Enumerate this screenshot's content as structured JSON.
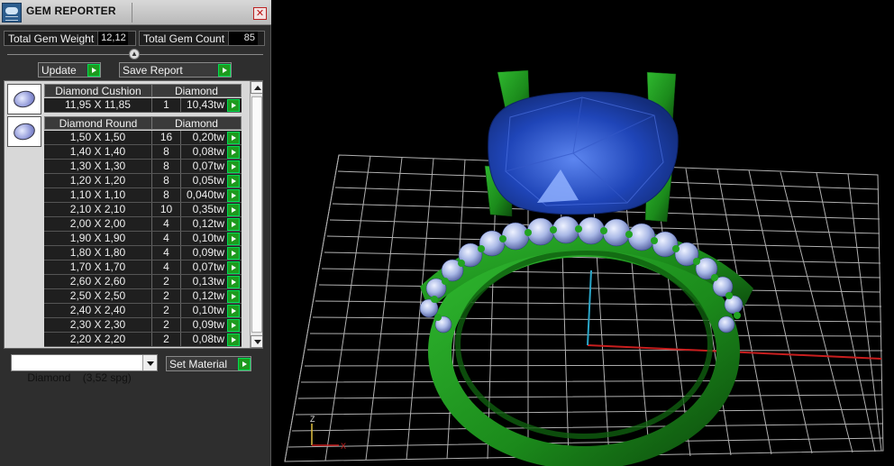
{
  "window": {
    "title": "GEM REPORTER",
    "close_symbol": "✕"
  },
  "totals": {
    "weight_label": "Total Gem Weight",
    "weight_value": "12,12",
    "count_label": "Total Gem Count",
    "count_value": "85"
  },
  "actions": {
    "update_label": "Update",
    "save_report_label": "Save Report",
    "set_material_label": "Set Material"
  },
  "groups": [
    {
      "shape": "Diamond Cushion",
      "material": "Diamond",
      "rows": [
        {
          "size": "11,95 X 11,85",
          "count": "1",
          "weight": "10,43tw"
        }
      ]
    },
    {
      "shape": "Diamond Round",
      "material": "Diamond",
      "rows": [
        {
          "size": "1,50 X 1,50",
          "count": "16",
          "weight": "0,20tw"
        },
        {
          "size": "1,40 X 1,40",
          "count": "8",
          "weight": "0,08tw"
        },
        {
          "size": "1,30 X 1,30",
          "count": "8",
          "weight": "0,07tw"
        },
        {
          "size": "1,20 X 1,20",
          "count": "8",
          "weight": "0,05tw"
        },
        {
          "size": "1,10 X 1,10",
          "count": "8",
          "weight": "0,040tw"
        },
        {
          "size": "2,10 X 2,10",
          "count": "10",
          "weight": "0,35tw"
        },
        {
          "size": "2,00 X 2,00",
          "count": "4",
          "weight": "0,12tw"
        },
        {
          "size": "1,90 X 1,90",
          "count": "4",
          "weight": "0,10tw"
        },
        {
          "size": "1,80 X 1,80",
          "count": "4",
          "weight": "0,09tw"
        },
        {
          "size": "1,70 X 1,70",
          "count": "4",
          "weight": "0,07tw"
        },
        {
          "size": "2,60 X 2,60",
          "count": "2",
          "weight": "0,13tw"
        },
        {
          "size": "2,50 X 2,50",
          "count": "2",
          "weight": "0,12tw"
        },
        {
          "size": "2,40 X 2,40",
          "count": "2",
          "weight": "0,10tw"
        },
        {
          "size": "2,30 X 2,30",
          "count": "2",
          "weight": "0,09tw"
        },
        {
          "size": "2,20 X 2,20",
          "count": "2",
          "weight": "0,08tw"
        }
      ]
    }
  ],
  "material": {
    "selected": "Diamond    (3,52 spg)"
  },
  "viewport": {
    "axis_z_label": "Z",
    "axis_x_label": "X",
    "colors": {
      "metal": "#1b8a1b",
      "center_stone": "#1f45b8",
      "side_stones": "#a9b8e6",
      "grid": "#cfcfcf",
      "axis_x": "#c81e1e",
      "axis_z": "#2aa6c8"
    }
  }
}
